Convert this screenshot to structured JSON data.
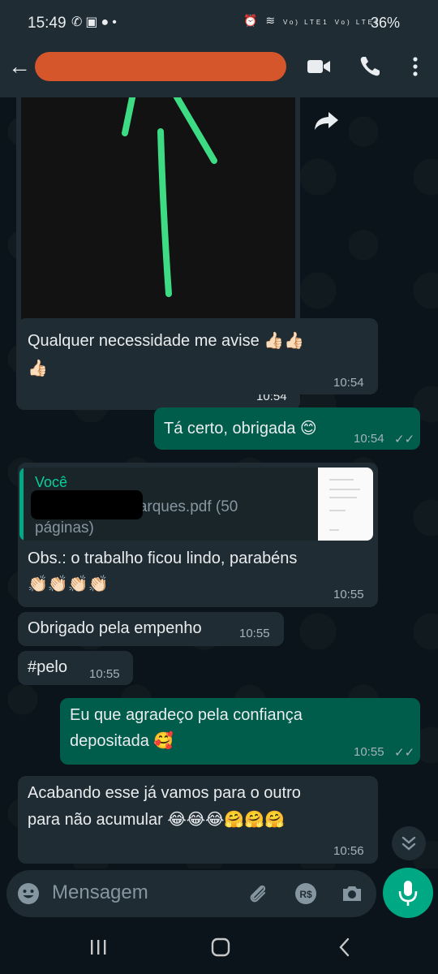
{
  "status_bar": {
    "time": "15:49",
    "left_icons": [
      "whatsapp-icon",
      "image-icon",
      "account-icon",
      "dot-icon"
    ],
    "right_icons": [
      "alarm-icon",
      "wifi-icon",
      "signal-lte1-icon",
      "signal-lte2-icon"
    ],
    "lte1": "Vo) LTE1",
    "lte2": "Vo) LTE2",
    "battery": "36%"
  },
  "header": {
    "contact_name": "",
    "icons": [
      "back-arrow-icon",
      "video-call-icon",
      "voice-call-icon",
      "more-options-icon"
    ]
  },
  "messages": [
    {
      "type": "image",
      "direction": "in",
      "time": "10:54",
      "forward_icon": "forward-icon"
    },
    {
      "type": "text",
      "direction": "in",
      "text": "Qualquer necessidade me avise 👍🏻👍🏻",
      "text2": "👍🏻",
      "time": "10:54"
    },
    {
      "type": "text",
      "direction": "out",
      "text": "Tá certo, obrigada 😊",
      "time": "10:54",
      "status": "read"
    },
    {
      "type": "reply",
      "direction": "in",
      "quote": {
        "author": "Você",
        "file": "Marques.pdf (50",
        "file2": "páginas)"
      },
      "text": "Obs.: o trabalho ficou lindo,  parabéns",
      "text2": "👏🏻👏🏻👏🏻👏🏻",
      "time": "10:55"
    },
    {
      "type": "text",
      "direction": "in",
      "text": "Obrigado pela empenho",
      "time": "10:55"
    },
    {
      "type": "text",
      "direction": "in",
      "text": "#pelo",
      "time": "10:55"
    },
    {
      "type": "text",
      "direction": "out",
      "text": "Eu que agradeço pela confiança",
      "text2": "depositada 🥰",
      "time": "10:55",
      "status": "read"
    },
    {
      "type": "text",
      "direction": "in",
      "text": "Acabando esse já vamos para o outro",
      "text2": "para não acumular 😂😂😂🤗🤗🤗",
      "time": "10:56"
    }
  ],
  "composer": {
    "placeholder": "Mensagem",
    "icons": [
      "emoji-icon",
      "attach-icon",
      "payment-icon",
      "camera-icon",
      "mic-icon"
    ],
    "pay_label": "R$"
  },
  "nav_bar": {
    "icons": [
      "recent-apps-icon",
      "home-icon",
      "back-icon"
    ]
  },
  "colors": {
    "background": "#0b141a",
    "incoming_bubble": "#202c33",
    "outgoing_bubble": "#005c4b",
    "accent": "#00a884",
    "redaction": "#d4562a"
  }
}
